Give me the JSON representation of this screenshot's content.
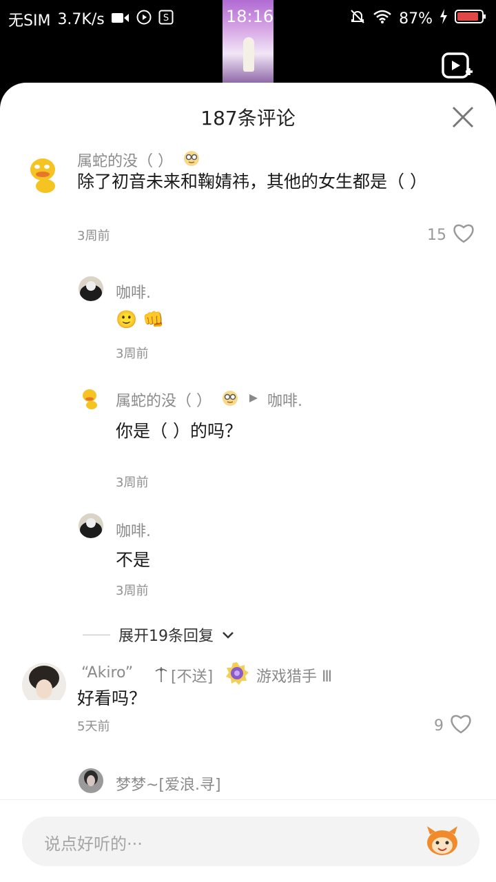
{
  "status_bar": {
    "carrier": "无SIM",
    "speed": "3.7K/s",
    "time": "18:16",
    "battery": "87%"
  },
  "sheet": {
    "title": "187条评论"
  },
  "comments": [
    {
      "username": "属蛇的没（ ）",
      "text": "除了初音未来和鞠婧祎，其他的女生都是（ ）",
      "time": "3周前",
      "likes": "15"
    },
    {
      "username": "咖啡.",
      "text": "🙂 👊",
      "time": "3周前"
    },
    {
      "username": "属蛇的没（ ）",
      "reply_to": "咖啡.",
      "text": "你是（ ）的吗？",
      "time": "3周前"
    },
    {
      "username": "咖啡.",
      "text": "不是",
      "time": "3周前"
    },
    {
      "username": "“Akiro”",
      "username_suffix": "[不送]",
      "badge": "游戏猎手 Ⅲ",
      "text": "好看吗？",
      "time": "5天前",
      "likes": "9"
    },
    {
      "username": "梦梦~[爱浪.寻]"
    }
  ],
  "expand_replies": "展开19条回复",
  "input": {
    "placeholder": "说点好听的···"
  },
  "colors": {
    "sheet_bg": "#ffffff",
    "name_gray": "#8a8a8a",
    "text_dark": "#1a1a1a",
    "input_bg": "#f3f3f3"
  }
}
